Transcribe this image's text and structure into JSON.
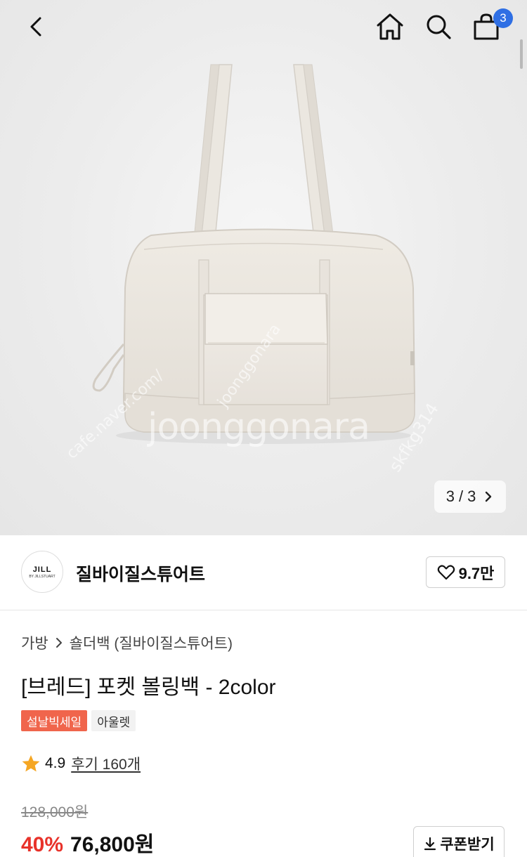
{
  "header": {
    "back_icon": "chevron-left-icon",
    "home_icon": "home-icon",
    "search_icon": "search-icon",
    "cart_icon": "shopping-bag-icon",
    "cart_count": "3",
    "badge_color": "#2f6fe4"
  },
  "gallery": {
    "current": "3",
    "separator": "/",
    "total": "3",
    "next_icon": "chevron-right-icon",
    "watermark": "joonggonara",
    "watermark_side": "cafe.naver.com/",
    "watermark_mid": "joonggonara",
    "watermark_right": "skfkg314"
  },
  "brand": {
    "logo_text": "JILL",
    "logo_subtext": "BY JILLSTUART",
    "name": "질바이질스튜어트",
    "like_icon": "heart-icon",
    "likes": "9.7만"
  },
  "product": {
    "breadcrumb_category": "가방",
    "breadcrumb_separator_icon": "chevron-right-icon",
    "breadcrumb_subcategory": "숄더백 (질바이질스튜어트)",
    "title": "[브레드] 포켓 볼링백 - 2color",
    "badges": [
      "설날빅세일",
      "아울렛"
    ],
    "sale_badge_color": "#f0654c",
    "rating_icon": "star-icon",
    "rating": "4.9",
    "review_label": "후기 160개",
    "original_price": "128,000원",
    "discount": "40%",
    "discount_color": "#e8322a",
    "price": "76,800원",
    "coupon_icon": "download-icon",
    "coupon_label": "쿠폰받기"
  }
}
